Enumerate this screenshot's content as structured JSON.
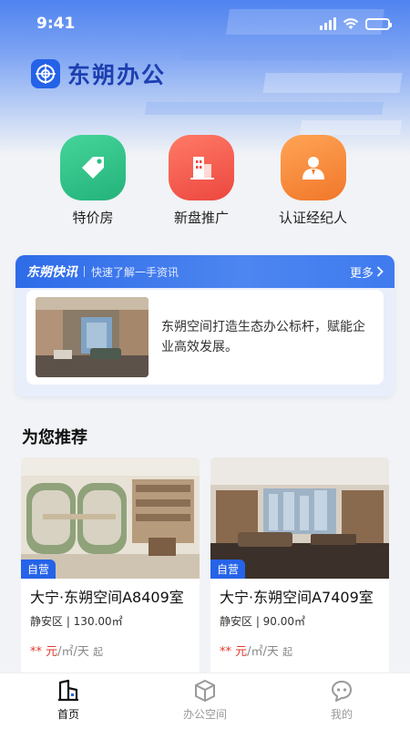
{
  "status_bar": {
    "time": "9:41"
  },
  "brand": {
    "name": "东朔办公"
  },
  "quick_links": [
    {
      "label": "特价房",
      "icon": "tag-icon",
      "color": "#2fbf86"
    },
    {
      "label": "新盘推广",
      "icon": "building-icon",
      "color": "#f0564d"
    },
    {
      "label": "认证经纪人",
      "icon": "agent-icon",
      "color": "#f6883c"
    }
  ],
  "news": {
    "tag": "东朔快讯",
    "subtitle": "快速了解一手资讯",
    "more": "更多",
    "text": "东朔空间打造生态办公标杆，赋能企业高效发展。"
  },
  "recommend": {
    "title": "为您推荐",
    "items": [
      {
        "badge": "自营",
        "title": "大宁·东朔空间A8409室",
        "meta": "静安区 | 130.00㎡",
        "price_mask": "**",
        "price_unit": "元",
        "price_suffix": "/㎡/天",
        "price_from": "起"
      },
      {
        "badge": "自营",
        "title": "大宁·东朔空间A7409室",
        "meta": "静安区 | 90.00㎡",
        "price_mask": "**",
        "price_unit": "元",
        "price_suffix": "/㎡/天",
        "price_from": "起"
      }
    ]
  },
  "tabbar": {
    "items": [
      {
        "label": "首页",
        "icon": "home-building-icon",
        "active": true
      },
      {
        "label": "办公空间",
        "icon": "cube-icon",
        "active": false
      },
      {
        "label": "我的",
        "icon": "profile-chat-icon",
        "active": false
      }
    ]
  },
  "colors": {
    "accent": "#2563e8",
    "price": "#e23b2e"
  }
}
